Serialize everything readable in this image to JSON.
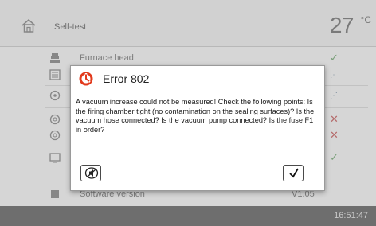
{
  "header": {
    "title": "Self-test",
    "temperature": "27",
    "temperature_unit": "°C"
  },
  "list": {
    "rows": [
      {
        "label": "Furnace head",
        "status": "✓"
      },
      {
        "label": "",
        "status": "⋰"
      },
      {
        "label": "",
        "status": "⋰"
      },
      {
        "label": "",
        "status": "✕"
      },
      {
        "label": "",
        "status": "✕"
      },
      {
        "label": "",
        "status": "✓"
      },
      {
        "label": "Software version",
        "value": "V1.05"
      }
    ]
  },
  "dialog": {
    "title": "Error 802",
    "message": "A vacuum increase could not be measured! Check the following points: Is the firing chamber tight (no contamination on the sealing surfaces)? Is the vacuum hose connected? Is the vacuum pump connected? Is the fuse F1 in order?",
    "icons": {
      "error": "error-icon",
      "mute": "mute-alarm-icon",
      "confirm": "checkmark-icon"
    },
    "confirm_label": "✓"
  },
  "footer": {
    "clock": "16:51:47"
  },
  "colors": {
    "accent_error": "#e23a1c",
    "footer_bg": "#7c7c7c",
    "ok_status": "#8ab88a",
    "error_status": "#d27878"
  }
}
